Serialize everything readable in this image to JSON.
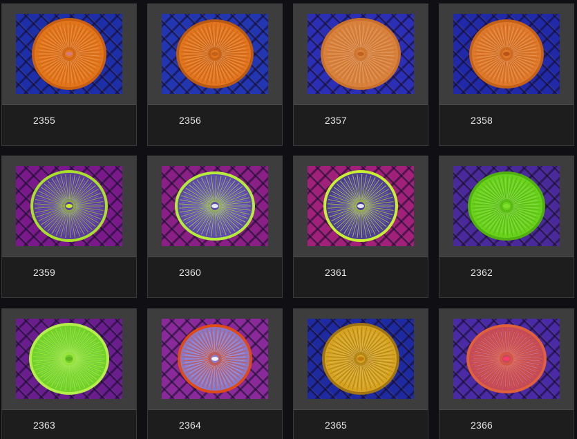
{
  "items": [
    {
      "id": "2355",
      "bg": "#1d2fa8",
      "coral": "#e2761c",
      "rim": "#c85f12",
      "center": "#d67a7a"
    },
    {
      "id": "2356",
      "bg": "#2136b0",
      "coral": "#e2751e",
      "rim": "#b85a14",
      "center": "#c2611a"
    },
    {
      "id": "2357",
      "bg": "#2a2fb5",
      "coral": "#d9823d",
      "rim": "#c8702c",
      "center": "#c26020"
    },
    {
      "id": "2358",
      "bg": "#202aa8",
      "coral": "#df7a2c",
      "rim": "#c46118",
      "center": "#b85318"
    },
    {
      "id": "2359",
      "bg": "#7a1a8a",
      "coral": "#5b3b9c",
      "rim": "#a8e02a",
      "center": "#c8f02a"
    },
    {
      "id": "2360",
      "bg": "#8a1f86",
      "coral": "#5e4aa8",
      "rim": "#b5ec3a",
      "center": "#e6e6ff"
    },
    {
      "id": "2361",
      "bg": "#a0207a",
      "coral": "#4e3e93",
      "rim": "#c6f031",
      "center": "#e4e4ff"
    },
    {
      "id": "2362",
      "bg": "#4a2a9a",
      "coral": "#6ad11c",
      "rim": "#4fb00f",
      "center": "#7fe02a"
    },
    {
      "id": "2363",
      "bg": "#6a1e8e",
      "coral": "#71d12a",
      "rim": "#b4f04a",
      "center": "#5fb61e"
    },
    {
      "id": "2364",
      "bg": "#8a2a9a",
      "coral": "#8a78c8",
      "rim": "#e04a14",
      "center": "#f0f0ff"
    },
    {
      "id": "2365",
      "bg": "#1e2aa0",
      "coral": "#d6a420",
      "rim": "#a07412",
      "center": "#c07a10"
    },
    {
      "id": "2366",
      "bg": "#4a2aa5",
      "coral": "#c24a5a",
      "rim": "#e0603a",
      "center": "#ff3a6a"
    }
  ]
}
